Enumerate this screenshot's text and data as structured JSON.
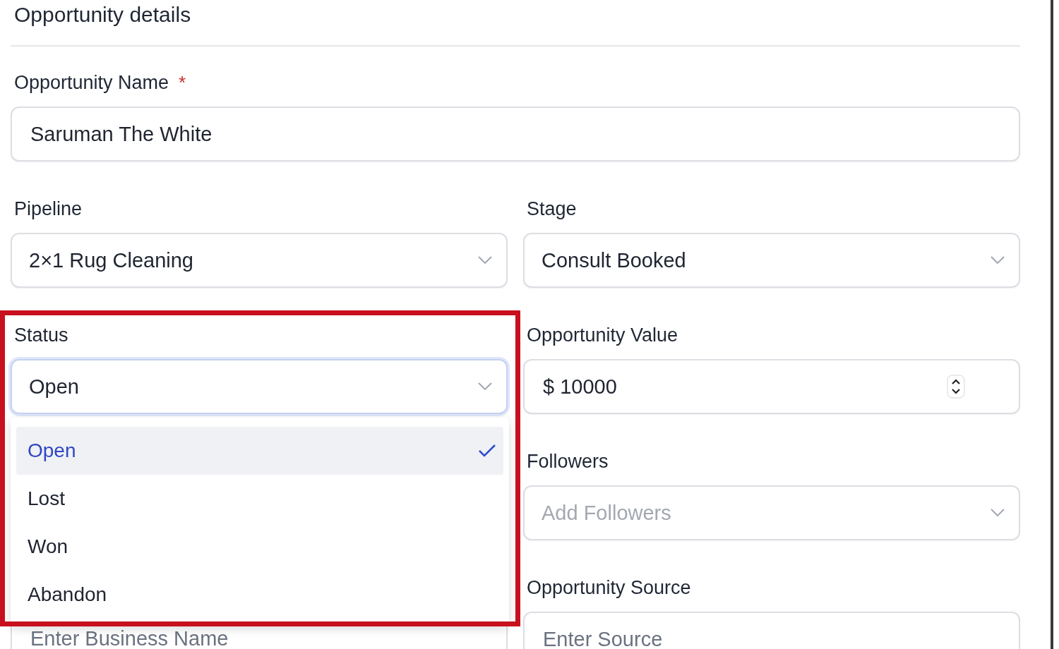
{
  "header": {
    "title": "Opportunity details"
  },
  "name_field": {
    "label": "Opportunity Name",
    "required_mark": "*",
    "value": "Saruman The White"
  },
  "left_column": [
    {
      "kind": "select",
      "label": "Pipeline",
      "value": "2×1 Rug Cleaning",
      "focused": false
    },
    {
      "kind": "select",
      "label": "Status",
      "value": "Open",
      "focused": true,
      "highlighted": true,
      "options": [
        {
          "label": "Open",
          "selected": true
        },
        {
          "label": "Lost",
          "selected": false
        },
        {
          "label": "Won",
          "selected": false
        },
        {
          "label": "Abandon",
          "selected": false
        }
      ]
    },
    {
      "kind": "text",
      "placeholder": "Enter Business Name"
    }
  ],
  "right_column": [
    {
      "kind": "select",
      "label": "Stage",
      "value": "Consult Booked",
      "focused": false
    },
    {
      "kind": "number",
      "label": "Opportunity Value",
      "value": "$ 10000"
    },
    {
      "kind": "select",
      "label": "Followers",
      "placeholder": "Add Followers",
      "focused": false
    },
    {
      "kind": "text",
      "label": "Opportunity Source",
      "placeholder": "Enter Source"
    }
  ]
}
